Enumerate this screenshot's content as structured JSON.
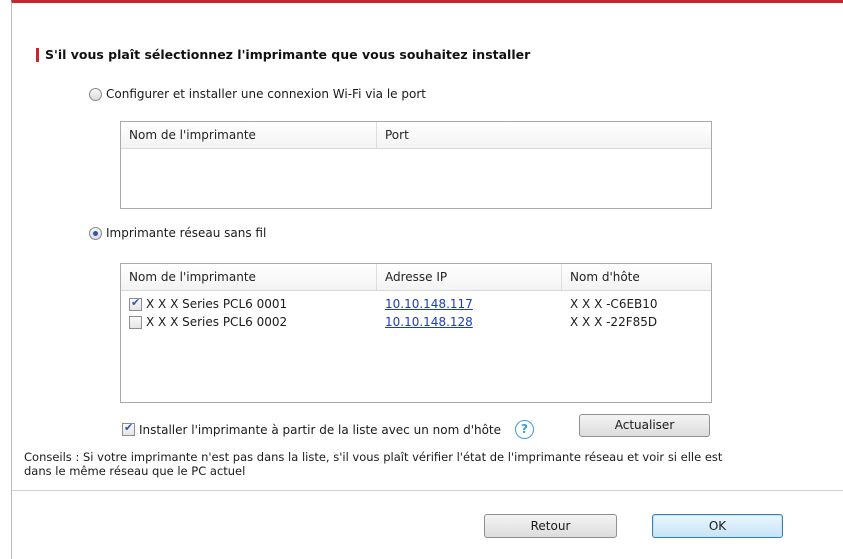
{
  "dialog": {
    "heading": "S'il vous plaît sélectionnez l'imprimante que vous souhaitez installer"
  },
  "option_port": {
    "label": "Configurer et installer une connexion Wi-Fi via le port",
    "selected": false,
    "columns": [
      "Nom de l'imprimante",
      "Port"
    ],
    "rows": []
  },
  "option_wireless": {
    "label": "Imprimante réseau sans fil",
    "selected": true,
    "columns": [
      "Nom de l'imprimante",
      "Adresse IP",
      "Nom d'hôte"
    ],
    "rows": [
      {
        "checked": true,
        "name": "X X X Series PCL6 0001",
        "ip": "10.10.148.117",
        "host": "X X X -C6EB10"
      },
      {
        "checked": false,
        "name": "X X X Series PCL6 0002",
        "ip": "10.10.148.128",
        "host": "X X X -22F85D"
      }
    ]
  },
  "install_by_hostname": {
    "label": "Installer l'imprimante à partir de la liste avec un nom d'hôte",
    "checked": true,
    "help_glyph": "?"
  },
  "buttons": {
    "refresh": "Actualiser",
    "back": "Retour",
    "ok": "OK"
  },
  "tips": {
    "line1": "Conseils : Si votre imprimante n'est pas dans la liste, s'il vous plaît vérifier l'état de l'imprimante réseau et voir si elle est",
    "line2": "dans le même réseau que le PC actuel"
  },
  "colors": {
    "accent_red": "#c8252c",
    "link_blue": "#1b3cc2",
    "help_blue": "#3aa0d8"
  }
}
